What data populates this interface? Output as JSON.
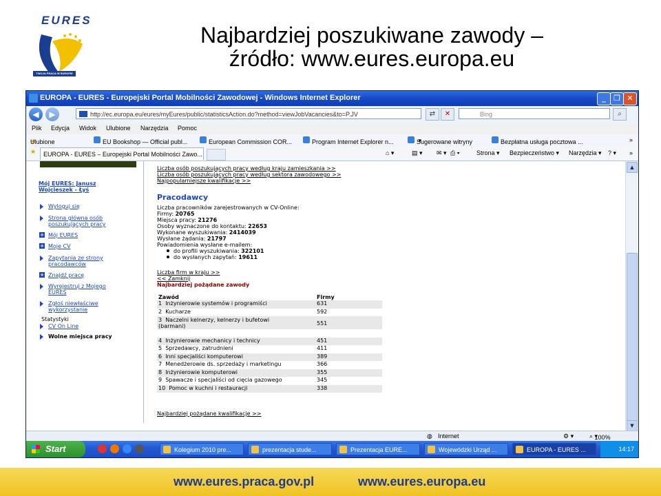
{
  "slide": {
    "title_line1": "Najbardziej poszukiwane zawody –",
    "title_line2": "źródło: www.eures.europa.eu",
    "logo_text": "EURES",
    "logo_subtitle": "TWOJA PRACA W EUROPIE",
    "footer_left": "www.eures.praca.gov.pl",
    "footer_right": "www.eures.europa.eu"
  },
  "browser": {
    "window_title": "EUROPA - EURES - Europejski Portal Mobilności Zawodowej - Windows Internet Explorer",
    "url": "http://ec.europa.eu/eures/myEures/public/statisticsAction.do?method=viewJobVacancies&to=P.JV",
    "search_placeholder": "Bing",
    "menu": [
      "Plik",
      "Edycja",
      "Widok",
      "Ulubione",
      "Narzędzia",
      "Pomoc"
    ],
    "favorites_label": "Ulubione",
    "favorites": [
      "EU Bookshop — Official publ...",
      "European Commission COR...",
      "Program Internet Explorer n...",
      "Sugerowane witryny",
      "Bezpłatna usługa pocztowa ..."
    ],
    "tab_label": "EUROPA - EURES – Europejski Portal Mobilności Zawo...",
    "commands": [
      "Strona",
      "Bezpieczeństwo",
      "Narzędzia"
    ],
    "status_zone": "Internet",
    "zoom": "100%"
  },
  "sidebar": {
    "user": "Mój EURES: Janusz Wojcieszek - Łyś",
    "items": [
      {
        "label_line1": "Wyloguj się",
        "label_line2": ""
      },
      {
        "label_line1": "Strona główna osób",
        "label_line2": "poszukujących pracy"
      },
      {
        "label_line1": "Mój EURES",
        "label_line2": ""
      },
      {
        "label_line1": "Moje CV",
        "label_line2": ""
      },
      {
        "label_line1": "Zapytania ze strony",
        "label_line2": "pracodawców"
      },
      {
        "label_line1": "Znajdź pracę",
        "label_line2": ""
      },
      {
        "label_line1": "Wyrejestruj z Mojego",
        "label_line2": "EURES"
      },
      {
        "label_line1": "Zgłoś niewłaściwe",
        "label_line2": "wykorzystanie"
      }
    ],
    "section_stats": "Statystyki",
    "sub_items": [
      "CV On Line",
      "Wolne miejsca pracy"
    ]
  },
  "main": {
    "top_links": [
      "Liczba osób poszukujących pracy według kraju zamieszkania >>",
      "Liczba osób poszukujących pracy według sektora zawodowego >>",
      "Najpopularniejsze kwalifikacje >>"
    ],
    "heading": "Pracodawcy",
    "intro": "Liczba pracowników zarejestrowanych w CV-Online:",
    "stats": [
      {
        "label": "Firmy:",
        "value": "20765"
      },
      {
        "label": "Miejsca pracy:",
        "value": "21276"
      },
      {
        "label": "Osoby wyznaczone do kontaktu:",
        "value": "22653"
      },
      {
        "label": "Wykonane wyszukiwania:",
        "value": "2414039"
      },
      {
        "label": "Wysłane żądania:",
        "value": "21797"
      }
    ],
    "notifications": "Powiadomienia wysłane e-mailem:",
    "notif_items": [
      {
        "label": "do profili wyszukiwania:",
        "value": "322101"
      },
      {
        "label": "do wysłanych zapytań:",
        "value": "19611"
      }
    ],
    "link_firms": "Liczba firm w kraju >>",
    "link_close": "<< Zamknij",
    "table_title": "Najbardziej pożądane zawody",
    "table": {
      "headers": [
        "Zawód",
        "Firmy"
      ],
      "rows": [
        {
          "num": "1",
          "name_line1": "Inżynierowie systemów i programiści",
          "name_line2": "",
          "value": "631"
        },
        {
          "num": "2",
          "name_line1": "Kucharze",
          "name_line2": "",
          "value": "592"
        },
        {
          "num": "3",
          "name_line1": "Naczelni kelnerzy, kelnerzy i bufetowi",
          "name_line2": "(barmani)",
          "value": "551"
        },
        {
          "num": "4",
          "name_line1": "Inżynierowie mechanicy i technicy",
          "name_line2": "",
          "value": "451"
        },
        {
          "num": "5",
          "name_line1": "Sprzedawcy, zatrudnieni",
          "name_line2": "",
          "value": "411"
        },
        {
          "num": "6",
          "name_line1": "Inni specjaliści komputerowi",
          "name_line2": "",
          "value": "389"
        },
        {
          "num": "7",
          "name_line1": "Menedżerowie ds. sprzedaży i marketingu",
          "name_line2": "",
          "value": "366"
        },
        {
          "num": "8",
          "name_line1": "Inżynierowie komputerowi",
          "name_line2": "",
          "value": "355"
        },
        {
          "num": "9",
          "name_line1": "Spawacze i specjaliści od cięcia gazowego",
          "name_line2": "",
          "value": "345"
        },
        {
          "num": "10",
          "name_line1": "Pomoc w kuchni i restauracji",
          "name_line2": "",
          "value": "338"
        }
      ]
    },
    "link_qual": "Najbardziej pożądane kwalifikacje >>"
  },
  "taskbar": {
    "start": "Start",
    "buttons": [
      "Kolegium 2010 pre...",
      "prezentacja stude...",
      "Prezentacja EURE...",
      "Wojewódzki Urząd ...",
      "EUROPA - EURES ..."
    ],
    "clock": "14:17"
  }
}
